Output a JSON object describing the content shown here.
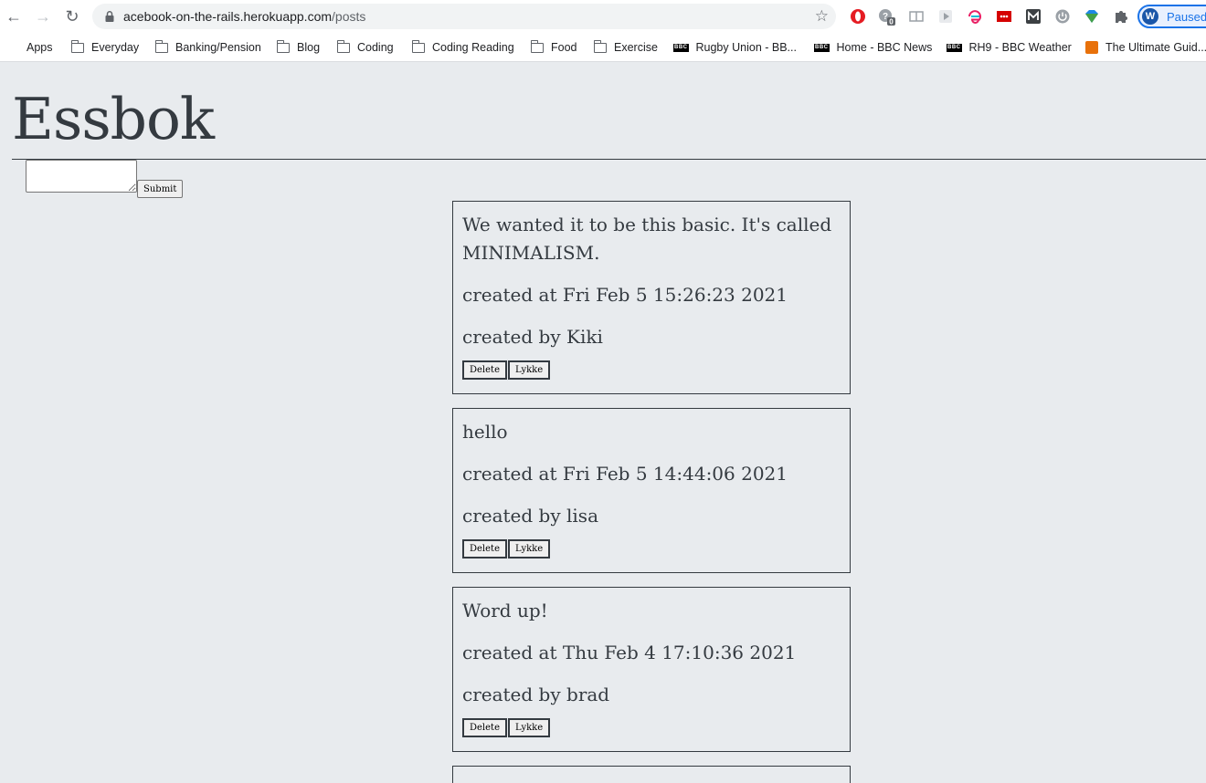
{
  "browser": {
    "url_host": "acebook-on-the-rails.herokuapp.com",
    "url_path": "/posts",
    "profile_initial": "W",
    "profile_status": "Paused",
    "extension_badge": "0",
    "bookmarks": [
      {
        "label": "Apps",
        "icon": "apps-icon"
      },
      {
        "label": "Everyday",
        "icon": "folder-icon"
      },
      {
        "label": "Banking/Pension",
        "icon": "folder-icon"
      },
      {
        "label": "Blog",
        "icon": "folder-icon"
      },
      {
        "label": "Coding",
        "icon": "folder-icon"
      },
      {
        "label": "Coding Reading",
        "icon": "folder-icon"
      },
      {
        "label": "Food",
        "icon": "folder-icon"
      },
      {
        "label": "Exercise",
        "icon": "folder-icon"
      },
      {
        "label": "Rugby Union - BB...",
        "icon": "bbc-icon"
      },
      {
        "label": "Home - BBC News",
        "icon": "bbc-icon"
      },
      {
        "label": "RH9 - BBC Weather",
        "icon": "bbc-icon"
      },
      {
        "label": "The Ultimate Guid...",
        "icon": "orange-bookmark-icon"
      }
    ]
  },
  "page": {
    "title": "Essbok",
    "submit_label": "Submit",
    "post_input_value": ""
  },
  "posts": [
    {
      "message": "We wanted it to be this basic. It's called MINIMALISM.",
      "created_at": "created at Fri Feb 5 15:26:23 2021",
      "created_by": "created by Kiki",
      "delete_label": "Delete",
      "like_label": "Lykke"
    },
    {
      "message": "hello",
      "created_at": "created at Fri Feb 5 14:44:06 2021",
      "created_by": "created by lisa",
      "delete_label": "Delete",
      "like_label": "Lykke"
    },
    {
      "message": "Word up!",
      "created_at": "created at Thu Feb 4 17:10:36 2021",
      "created_by": "created by brad",
      "delete_label": "Delete",
      "like_label": "Lykke"
    }
  ],
  "colors": {
    "page_background": "#e8ebee",
    "text": "#343a40"
  }
}
